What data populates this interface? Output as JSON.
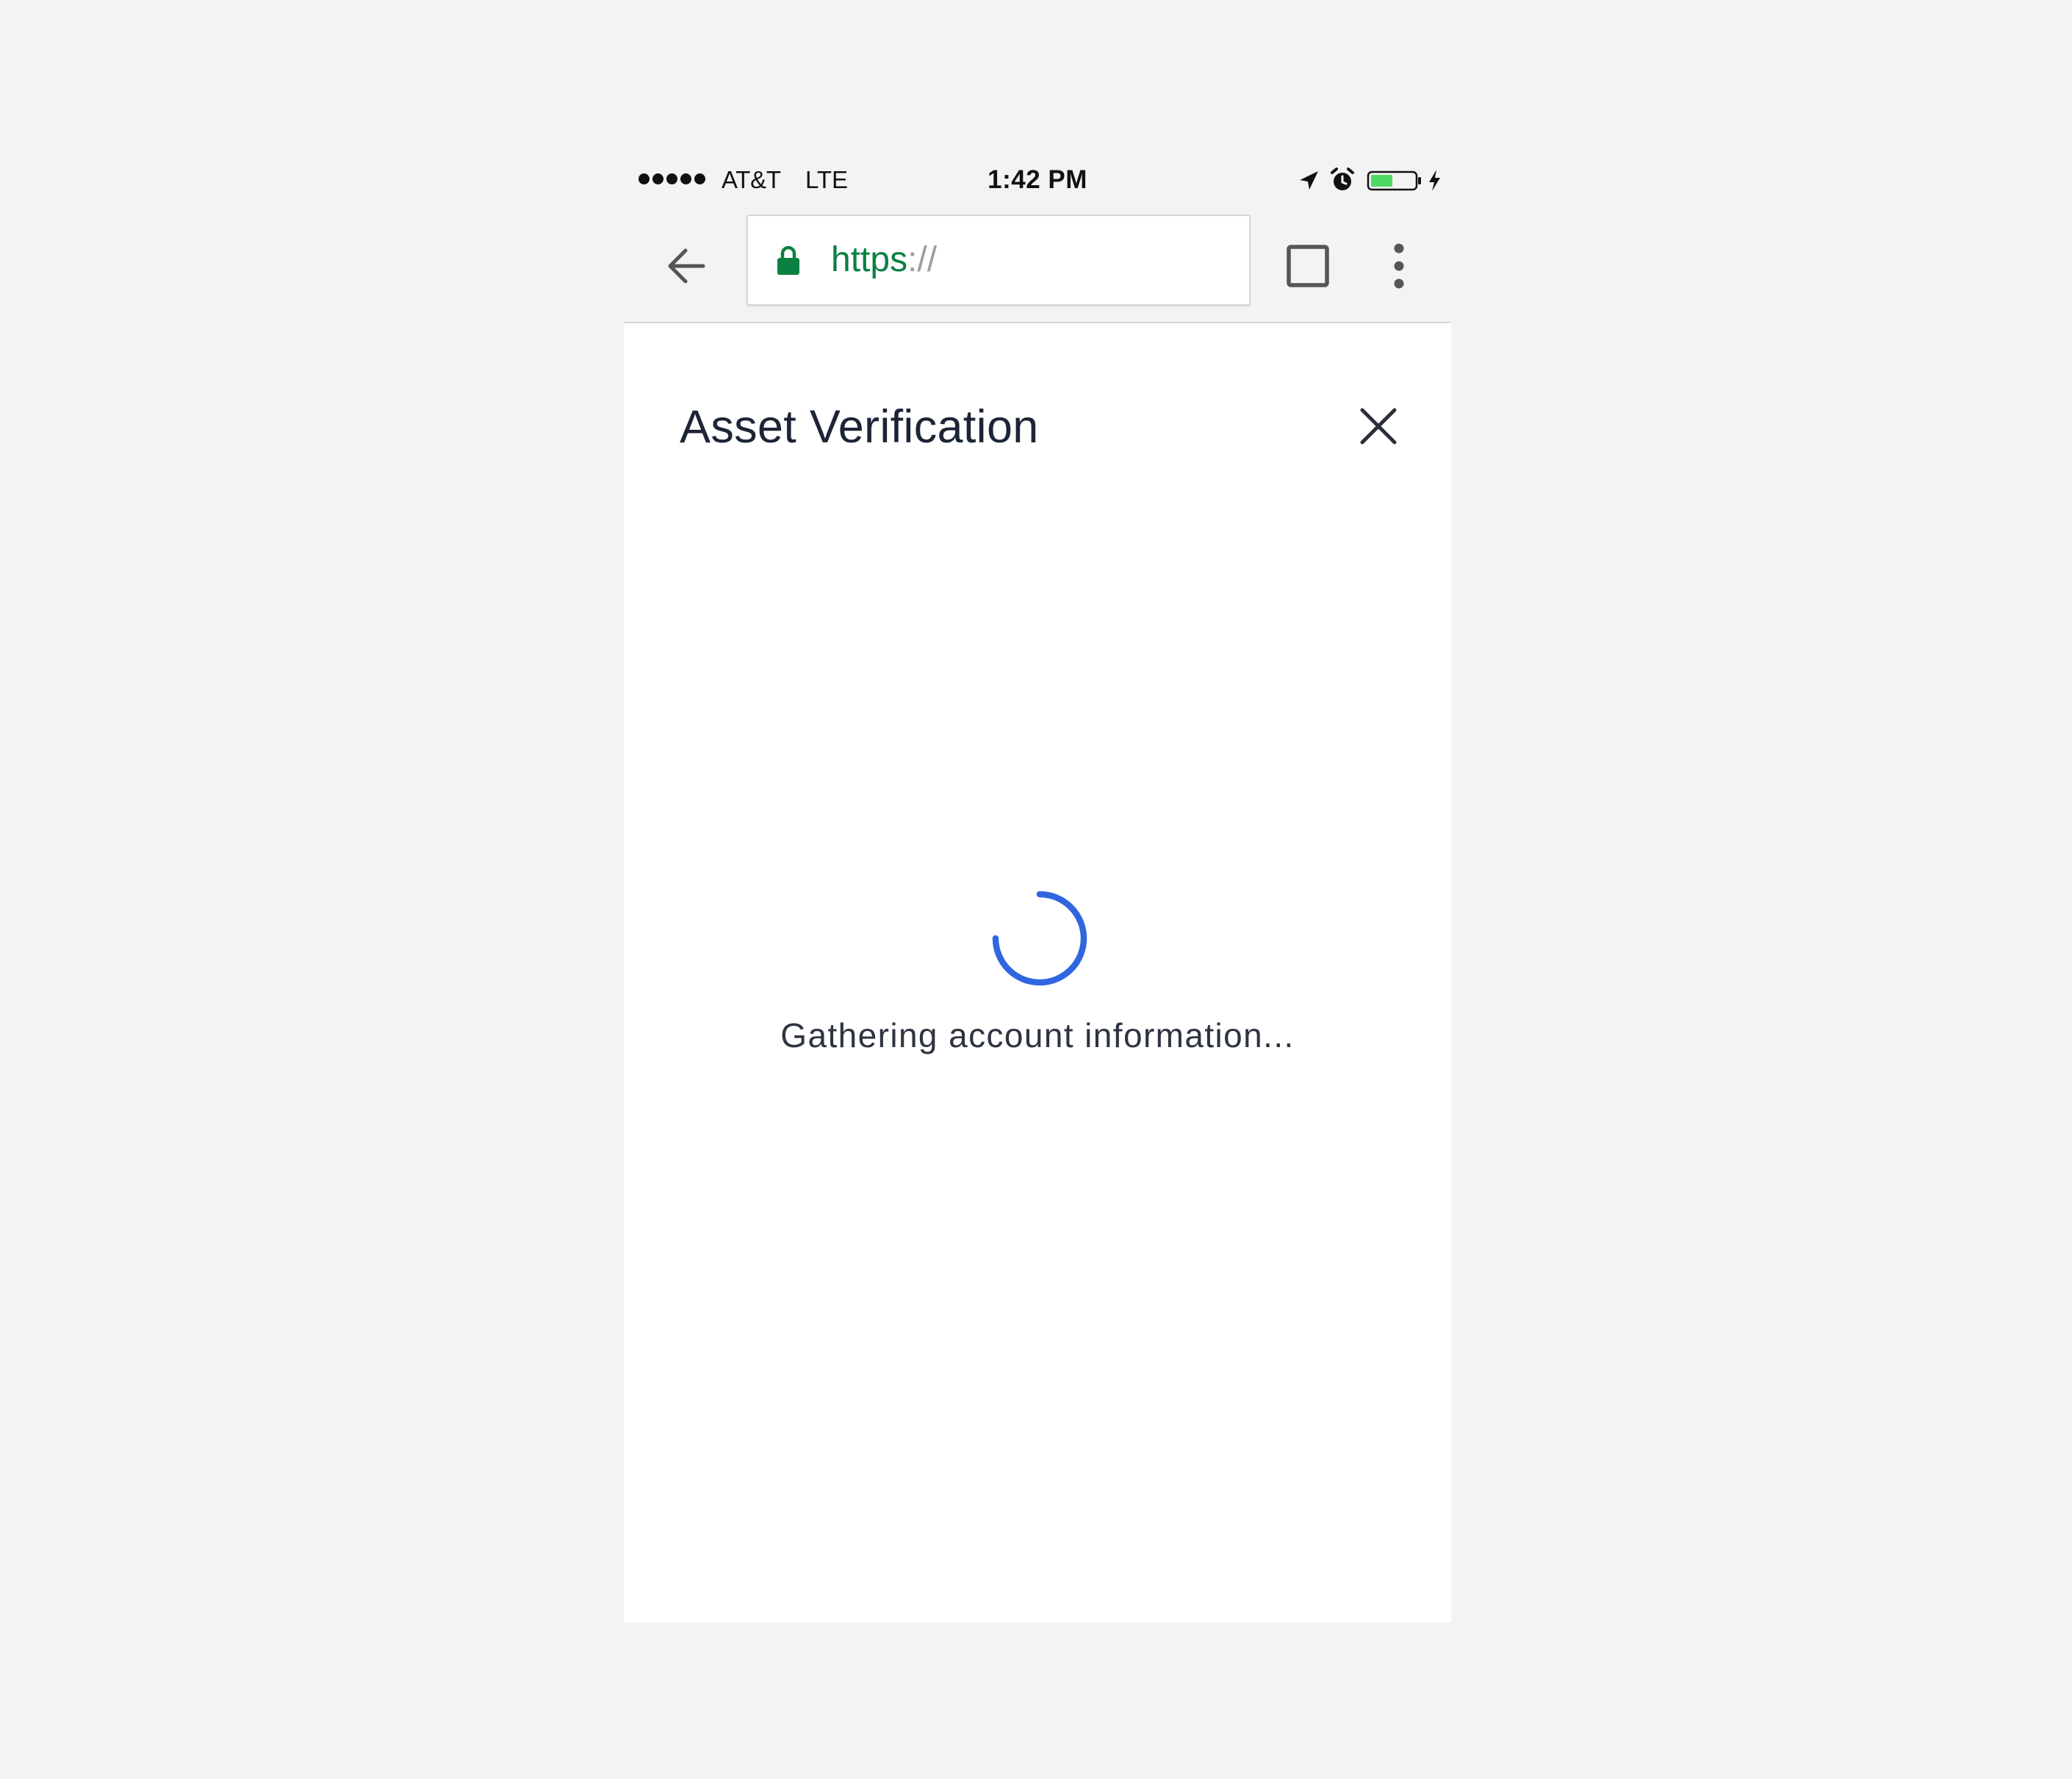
{
  "status_bar": {
    "carrier": "AT&T",
    "network": "LTE",
    "time": "1:42 PM",
    "signal_bars": 5,
    "battery_level": 0.5,
    "battery_color": "#4cd964",
    "icons": [
      "location-arrow-icon",
      "alarm-icon",
      "battery-icon",
      "charging-bolt-icon"
    ]
  },
  "browser": {
    "url_scheme": "https",
    "url_separator": "://",
    "secure": true,
    "secure_color": "#0b8043",
    "toolbar_icons": [
      "back-arrow-icon",
      "lock-icon",
      "tabs-icon",
      "overflow-menu-icon"
    ]
  },
  "dialog": {
    "title": "Asset Verification",
    "close_icon": "close-icon",
    "loading_message": "Gathering account information...",
    "spinner_color": "#2f66e0"
  }
}
